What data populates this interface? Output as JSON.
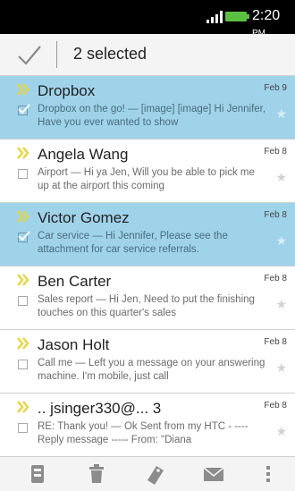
{
  "status": {
    "time": "2:20",
    "ampm": "PM"
  },
  "header": {
    "title": "2 selected"
  },
  "emails": [
    {
      "sender": "Dropbox",
      "date": "Feb 9",
      "snippet": "Dropbox on the go! — [image] [image] Hi Jennifer, Have you ever wanted to show",
      "selected": true
    },
    {
      "sender": "Angela Wang",
      "date": "Feb 8",
      "snippet": "Airport — Hi ya Jen, Will you be able to pick me up at the airport this coming",
      "selected": false
    },
    {
      "sender": "Victor Gomez",
      "date": "Feb 8",
      "snippet": "Car service — Hi Jennifer, Please see the attachment for car service referrals.",
      "selected": true
    },
    {
      "sender": "Ben Carter",
      "date": "Feb 8",
      "snippet": "Sales report — Hi Jen, Need to put the finishing touches on this quarter's sales",
      "selected": false
    },
    {
      "sender": "Jason Holt",
      "date": "Feb 8",
      "snippet": "Call me — Left you a message on your answering machine. I'm mobile, just call",
      "selected": false
    },
    {
      "sender": ".. jsinger330@...  3",
      "date": "Feb 8",
      "snippet": "RE: Thank you! — Ok Sent from my HTC - ---- Reply message ----- From: \"Diana",
      "selected": false
    }
  ],
  "icons": {
    "priority": "priority-chevron-icon",
    "star": "star-icon",
    "toolbar": [
      "archive-icon",
      "trash-icon",
      "label-icon",
      "mail-icon",
      "overflow-menu-icon"
    ]
  },
  "colors": {
    "selected_row": "#9fd3ea",
    "priority": "#e8d53a",
    "battery": "#59c13f"
  }
}
